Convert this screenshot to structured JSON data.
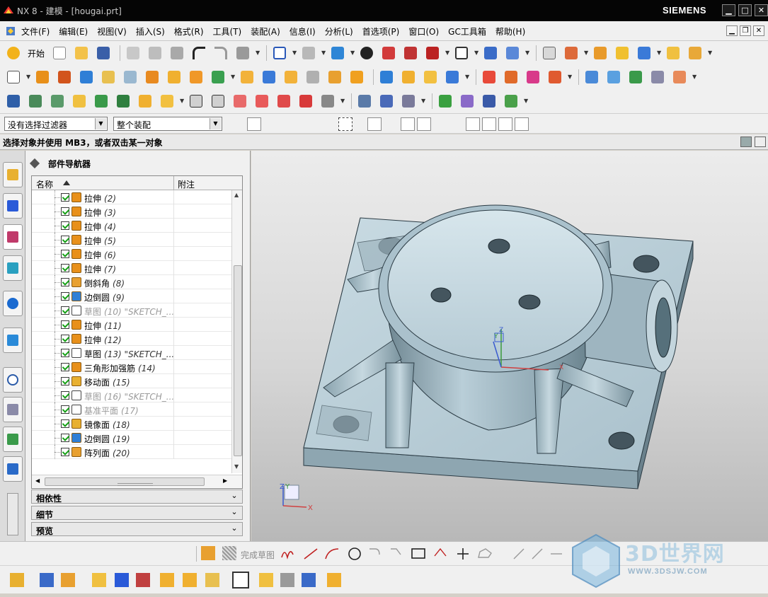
{
  "titlebar": {
    "title": "NX 8 - 建模 - [hougai.prt]",
    "brand": "SIEMENS"
  },
  "menubar": {
    "items": [
      {
        "label": "文件(F)"
      },
      {
        "label": "编辑(E)"
      },
      {
        "label": "视图(V)"
      },
      {
        "label": "插入(S)"
      },
      {
        "label": "格式(R)"
      },
      {
        "label": "工具(T)"
      },
      {
        "label": "装配(A)"
      },
      {
        "label": "信息(I)"
      },
      {
        "label": "分析(L)"
      },
      {
        "label": "首选项(P)"
      },
      {
        "label": "窗口(O)"
      },
      {
        "label": "GC工具箱"
      },
      {
        "label": "帮助(H)"
      }
    ]
  },
  "toolbar": {
    "start_label": "开始"
  },
  "filterbar": {
    "selection_filter": "没有选择过滤器",
    "scope": "整个装配"
  },
  "status": {
    "prompt": "选择对象并使用 MB3，或者双击某一对象"
  },
  "navigator": {
    "title": "部件导航器",
    "col_name": "名称",
    "col_note": "附注",
    "rows": [
      {
        "name": "拉伸",
        "seq": "(2)",
        "icon": "extrude-icon",
        "dim": false
      },
      {
        "name": "拉伸",
        "seq": "(3)",
        "icon": "extrude-icon",
        "dim": false
      },
      {
        "name": "拉伸",
        "seq": "(4)",
        "icon": "extrude-icon",
        "dim": false
      },
      {
        "name": "拉伸",
        "seq": "(5)",
        "icon": "extrude-icon",
        "dim": false
      },
      {
        "name": "拉伸",
        "seq": "(6)",
        "icon": "extrude-icon",
        "dim": false
      },
      {
        "name": "拉伸",
        "seq": "(7)",
        "icon": "extrude-icon",
        "dim": false
      },
      {
        "name": "倒斜角",
        "seq": "(8)",
        "icon": "chamfer-icon",
        "dim": false
      },
      {
        "name": "边倒圆",
        "seq": "(9)",
        "icon": "edge-blend-icon",
        "dim": false
      },
      {
        "name": "草图",
        "seq": "(10) \"SKETCH_...",
        "icon": "sketch-icon",
        "dim": true
      },
      {
        "name": "拉伸",
        "seq": "(11)",
        "icon": "extrude-icon",
        "dim": false
      },
      {
        "name": "拉伸",
        "seq": "(12)",
        "icon": "extrude-icon",
        "dim": false
      },
      {
        "name": "草图",
        "seq": "(13) \"SKETCH_...",
        "icon": "sketch-icon",
        "dim": false
      },
      {
        "name": "三角形加强筋",
        "seq": "(14)",
        "icon": "rib-icon",
        "dim": false
      },
      {
        "name": "移动面",
        "seq": "(15)",
        "icon": "move-face-icon",
        "dim": false
      },
      {
        "name": "草图",
        "seq": "(16) \"SKETCH_...",
        "icon": "sketch-icon",
        "dim": true
      },
      {
        "name": "基准平面",
        "seq": "(17)",
        "icon": "datum-plane-icon",
        "dim": true
      },
      {
        "name": "镜像面",
        "seq": "(18)",
        "icon": "mirror-face-icon",
        "dim": false
      },
      {
        "name": "边倒圆",
        "seq": "(19)",
        "icon": "edge-blend-icon",
        "dim": false
      },
      {
        "name": "阵列面",
        "seq": "(20)",
        "icon": "pattern-face-icon",
        "dim": false
      }
    ],
    "panels": [
      {
        "label": "相依性"
      },
      {
        "label": "细节"
      },
      {
        "label": "预览"
      }
    ]
  },
  "viewport": {
    "triad_labels": {
      "x": "X",
      "y": "Y",
      "z": "Z"
    }
  },
  "sketch_toolbar": {
    "finish_sketch": "完成草图"
  },
  "watermark": {
    "big": "3D世界网",
    "small": "WWW.3DSJW.COM"
  },
  "colors": {
    "title_bg": "#050505",
    "part_surface": "#b7ccd5",
    "accent_orange": "#e8901a",
    "check_green": "#15a015"
  }
}
